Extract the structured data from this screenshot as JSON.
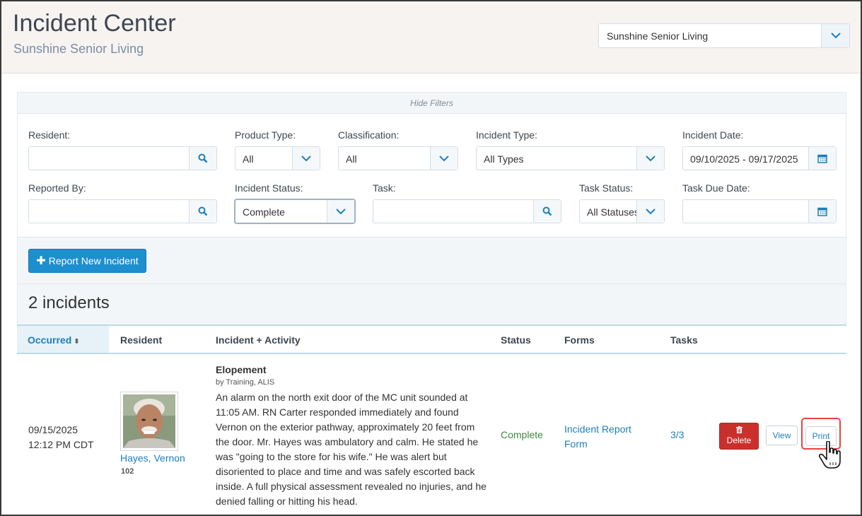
{
  "header": {
    "title": "Incident Center",
    "subtitle": "Sunshine Senior Living",
    "facility_select": "Sunshine Senior Living"
  },
  "filters": {
    "toggle_label": "Hide Filters",
    "resident": {
      "label": "Resident:",
      "value": ""
    },
    "product_type": {
      "label": "Product Type:",
      "value": "All"
    },
    "classification": {
      "label": "Classification:",
      "value": "All"
    },
    "incident_type": {
      "label": "Incident Type:",
      "value": "All Types"
    },
    "incident_date": {
      "label": "Incident Date:",
      "value": "09/10/2025 - 09/17/2025"
    },
    "reported_by": {
      "label": "Reported By:",
      "value": ""
    },
    "incident_status": {
      "label": "Incident Status:",
      "value": "Complete"
    },
    "task": {
      "label": "Task:",
      "value": ""
    },
    "task_status": {
      "label": "Task Status:",
      "value": "All Statuses"
    },
    "task_due_date": {
      "label": "Task Due Date:",
      "value": ""
    }
  },
  "actions": {
    "report_new": "Report New Incident"
  },
  "results": {
    "count_label": "2 incidents"
  },
  "table": {
    "columns": {
      "occurred": "Occurred",
      "resident": "Resident",
      "incident": "Incident + Activity",
      "status": "Status",
      "forms": "Forms",
      "tasks": "Tasks"
    },
    "rows": [
      {
        "occurred_date": "09/15/2025",
        "occurred_time": "12:12 PM CDT",
        "resident_name": "Hayes, Vernon",
        "resident_room": "102",
        "incident_title": "Elopement",
        "incident_by": "by Training, ALIS",
        "incident_description": "An alarm on the north exit door of the MC unit sounded at 11:05 AM. RN Carter responded immediately and found Vernon on the exterior pathway, approximately 20 feet from the door. Mr. Hayes was ambulatory and calm. He stated he was \"going to the store for his wife.\" He was alert but disoriented to place and time and was safely escorted back inside. A full physical assessment revealed no injuries, and he denied falling or hitting his head.",
        "status": "Complete",
        "form": "Incident Report Form",
        "tasks": "3/3",
        "delete_label": "Delete",
        "view_label": "View",
        "print_label": "Print"
      }
    ]
  },
  "colors": {
    "accent": "#1d8fcf",
    "link": "#1d7fba",
    "danger": "#c9302c",
    "complete": "#3c8a3c",
    "highlight": "#e64545"
  }
}
